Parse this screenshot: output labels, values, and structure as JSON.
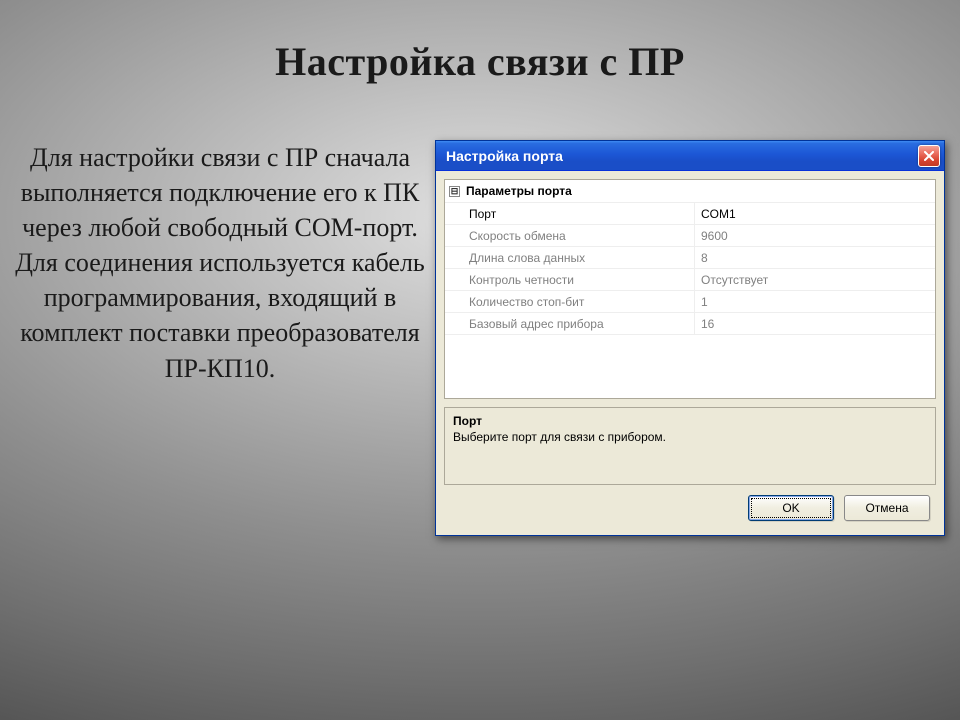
{
  "slide": {
    "title": "Настройка связи с ПР",
    "bodyText": "Для настройки связи с ПР сначала выполняется подключение его к ПК через любой свободный СОМ-порт. Для соединения используется кабель программирования, входящий в комплект поставки преобразователя ПР-КП10."
  },
  "dialog": {
    "title": "Настройка порта",
    "groupHeader": "Параметры порта",
    "expander": "⊟",
    "rows": [
      {
        "label": "Порт",
        "value": "COM1",
        "active": true
      },
      {
        "label": "Скорость обмена",
        "value": "9600",
        "active": false
      },
      {
        "label": "Длина слова данных",
        "value": "8",
        "active": false
      },
      {
        "label": "Контроль четности",
        "value": "Отсутствует",
        "active": false
      },
      {
        "label": "Количество стоп-бит",
        "value": "1",
        "active": false
      },
      {
        "label": "Базовый адрес прибора",
        "value": "16",
        "active": false
      }
    ],
    "help": {
      "title": "Порт",
      "text": "Выберите порт для связи с прибором."
    },
    "buttons": {
      "ok": "OK",
      "cancel": "Отмена"
    }
  }
}
